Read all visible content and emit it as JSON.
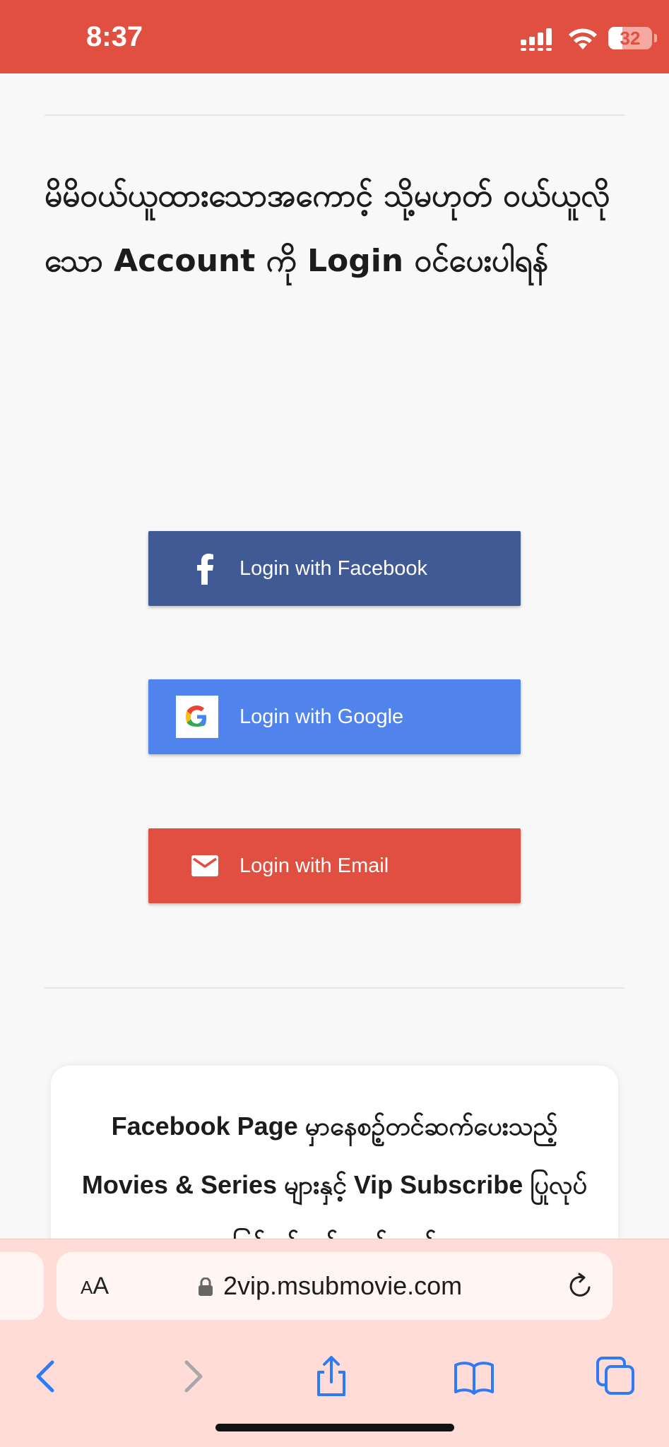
{
  "status_bar": {
    "time": "8:37",
    "battery": "32",
    "battery_fraction": 0.32,
    "icons": [
      "signal-icon",
      "wifi-icon",
      "battery-icon"
    ],
    "background": "#e04f3f"
  },
  "main": {
    "heading": "မိမိဝယ်ယူထားသောအကောင့် သို့မဟုတ် ဝယ်ယူလိုသော Account ကို Login ဝင်ပေးပါရန်",
    "login_buttons": [
      {
        "label": "Login with Facebook",
        "icon": "facebook-icon",
        "color": "#3f5a94"
      },
      {
        "label": "Login with Google",
        "icon": "google-icon",
        "color": "#5084ec"
      },
      {
        "label": "Login with Email",
        "icon": "mail-icon",
        "color": "#e04f3f"
      }
    ],
    "card_text": "Facebook Page မှာနေစဥ့်တင်ဆက်ပေးသည့် Movies & Series များနှင့် Vip Subscribe ပြုလုပ်ခြင်းနှင့်ပတ်သတ်သည့်"
  },
  "browser": {
    "aa_small": "A",
    "aa_big": "A",
    "url": "2vip.msubmovie.com",
    "icons": [
      "lock-icon",
      "reload-icon",
      "back-icon",
      "forward-icon",
      "share-icon",
      "bookmarks-icon",
      "tabs-icon"
    ]
  }
}
